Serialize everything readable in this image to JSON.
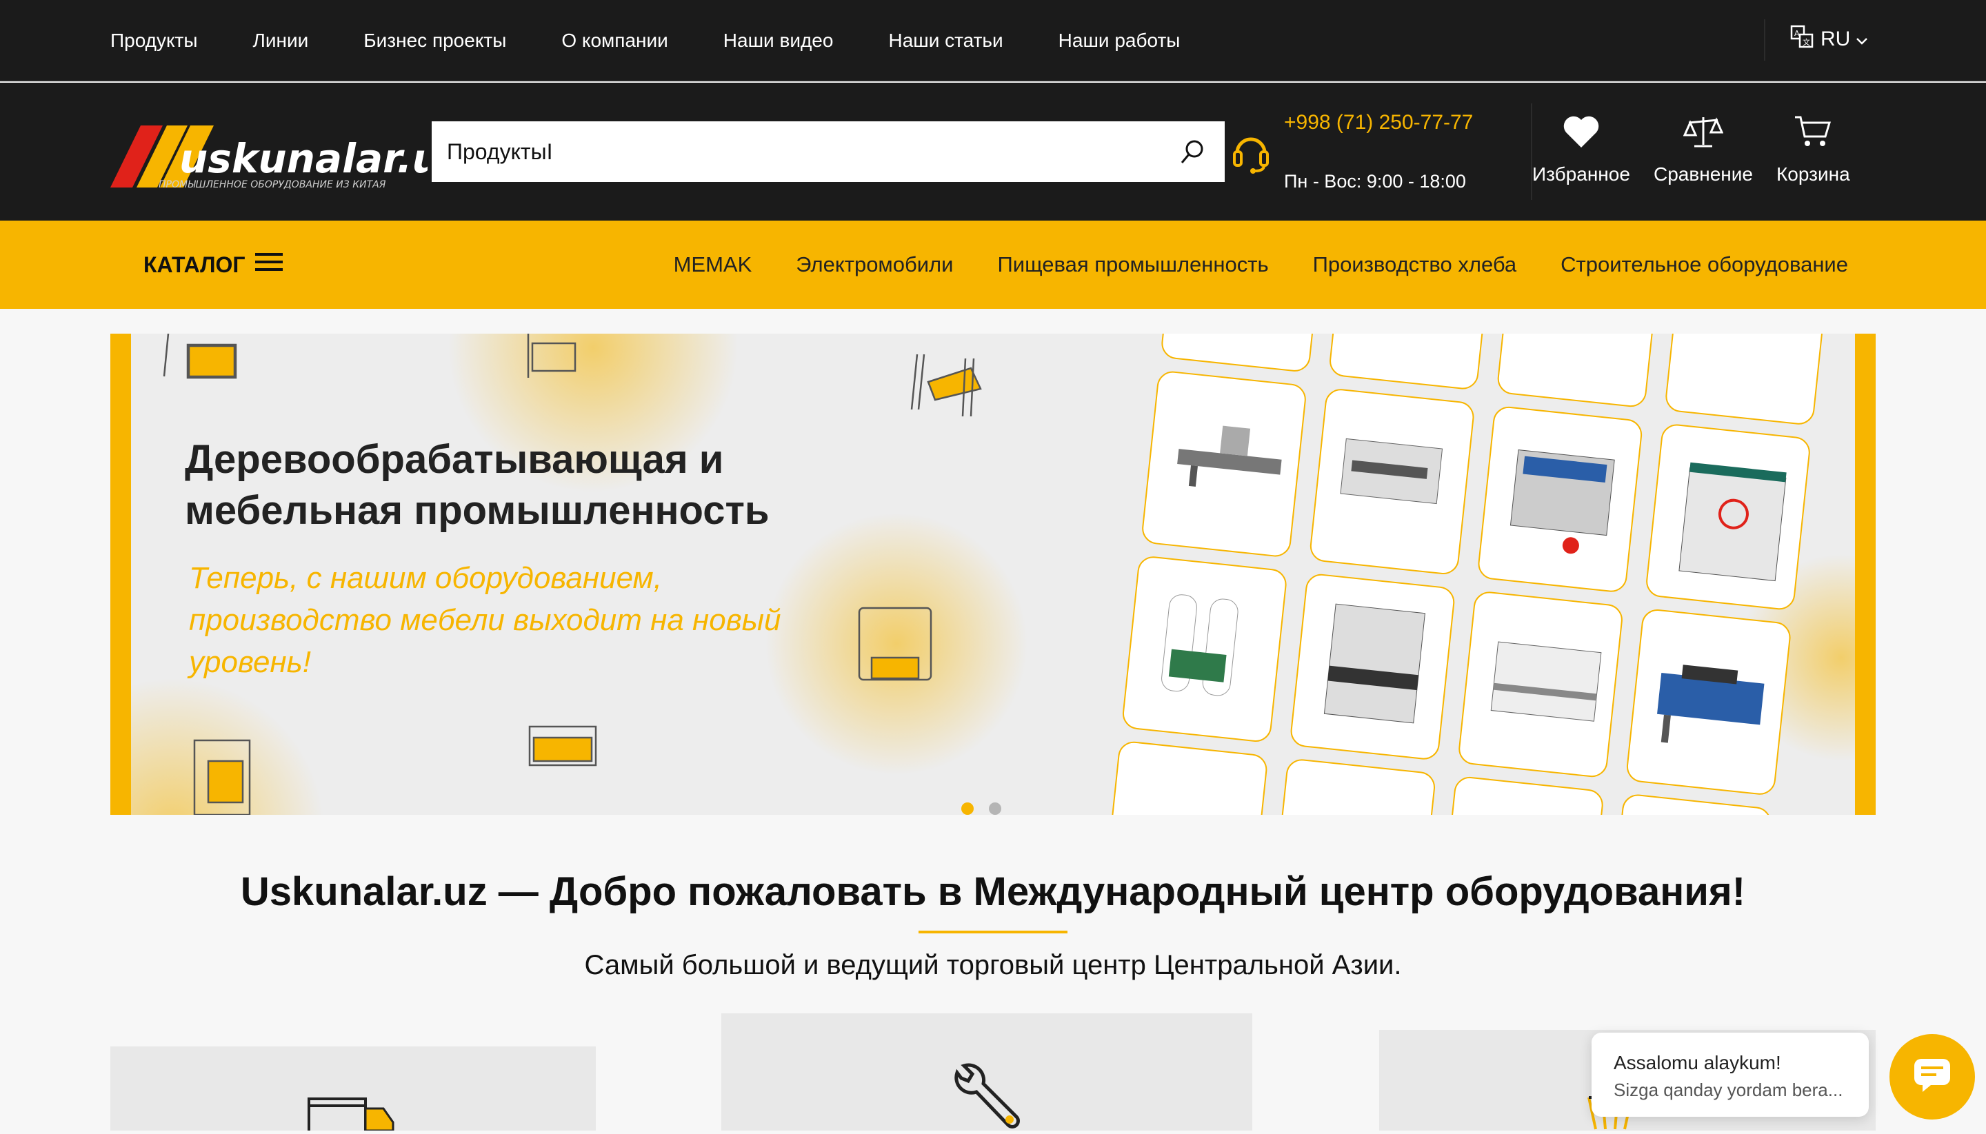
{
  "top_nav": [
    "Продукты",
    "Линии",
    "Бизнес проекты",
    "О компании",
    "Наши видео",
    "Наши статьи",
    "Наши работы"
  ],
  "lang": {
    "label": "RU",
    "icon": "translate-icon"
  },
  "logo": {
    "name": "uskunalar.uz",
    "tagline": "ПРОМЫШЛЕННОЕ ОБОРУДОВАНИЕ ИЗ КИТАЯ"
  },
  "search": {
    "value": "ПродуктыI",
    "icon": "search-icon"
  },
  "contact": {
    "phone": "+998 (71) 250-77-77",
    "hours": "Пн - Вос: 9:00 - 18:00",
    "icon": "headset-icon"
  },
  "header_actions": [
    {
      "label": "Избранное",
      "icon": "heart-icon"
    },
    {
      "label": "Сравнение",
      "icon": "scales-icon"
    },
    {
      "label": "Корзина",
      "icon": "cart-icon"
    }
  ],
  "catalog": {
    "label": "КАТАЛОГ",
    "icon": "menu-icon"
  },
  "category_links": [
    "MEMAK",
    "Электромобили",
    "Пищевая промышленность",
    "Производство хлеба",
    "Строительное оборудование"
  ],
  "banner": {
    "title": "Деревообрабатывающая и мебельная промышленность",
    "subtitle": "Теперь, с нашим оборудованием, производство мебели выходит на новый уровень!",
    "slides": 2,
    "active_slide": 1
  },
  "welcome": {
    "title": "Uskunalar.uz — Добро пожаловать в Международный центр оборудования!",
    "subtitle": "Самый большой и ведущий торговый центр Центральной Азии."
  },
  "chat": {
    "greeting": "Assalomu alaykum!",
    "message": "Sizga qanday yordam bera...",
    "icon": "chat-bubble-icon"
  },
  "colors": {
    "accent": "#f7b500",
    "dark": "#1b1b1b",
    "logo_red": "#e0221a"
  }
}
